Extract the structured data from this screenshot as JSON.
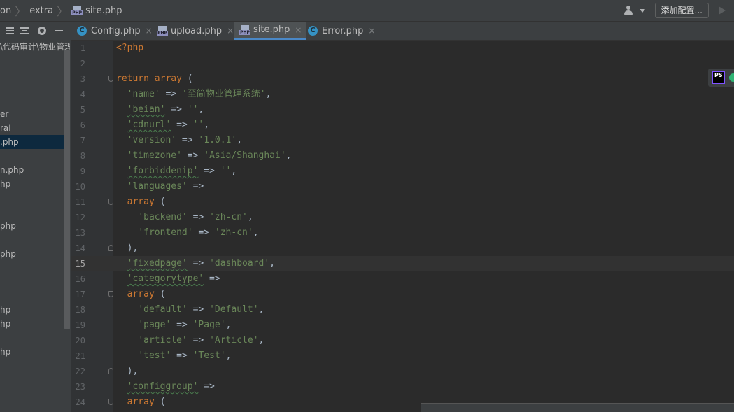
{
  "breadcrumbs": [
    "on",
    "extra",
    "site.php"
  ],
  "toolbar": {
    "config_button": "添加配置..."
  },
  "project_tree": [
    {
      "text": "\\代码审计\\物业管理",
      "selected": false
    },
    {
      "text": "er",
      "selected": false
    },
    {
      "text": "ral",
      "selected": false
    },
    {
      "text": ".php",
      "selected": true
    },
    {
      "text": "n.php",
      "selected": false
    },
    {
      "text": "hp",
      "selected": false
    },
    {
      "text": "php",
      "selected": false
    },
    {
      "text": "php",
      "selected": false
    },
    {
      "text": "hp",
      "selected": false
    },
    {
      "text": "hp",
      "selected": false
    },
    {
      "text": "hp",
      "selected": false
    }
  ],
  "tabs": [
    {
      "label": "Config.php",
      "icon": "php-class-icon",
      "active": false
    },
    {
      "label": "upload.php",
      "icon": "php-file-icon",
      "active": false
    },
    {
      "label": "site.php",
      "icon": "php-file-icon",
      "active": true
    },
    {
      "label": "Error.php",
      "icon": "php-class-icon",
      "active": false
    }
  ],
  "tab_close_glyph": "×",
  "plugin": {
    "logo_text": "PS"
  },
  "current_line": 15,
  "code_lines": [
    {
      "n": 1,
      "fold": "",
      "tokens": [
        [
          "kw",
          "<?php"
        ]
      ]
    },
    {
      "n": 2,
      "fold": "",
      "tokens": []
    },
    {
      "n": 3,
      "fold": "start",
      "tokens": [
        [
          "kw",
          "return array"
        ],
        [
          "plain",
          " ("
        ]
      ]
    },
    {
      "n": 4,
      "fold": "",
      "tokens": [
        [
          "plain",
          "  "
        ],
        [
          "str",
          "'name'"
        ],
        [
          "plain",
          " => "
        ],
        [
          "str",
          "'至简物业管理系统'"
        ],
        [
          "plain",
          ","
        ]
      ]
    },
    {
      "n": 5,
      "fold": "",
      "tokens": [
        [
          "plain",
          "  "
        ],
        [
          "str-typo",
          "'beian'"
        ],
        [
          "plain",
          " => "
        ],
        [
          "str",
          "''"
        ],
        [
          "plain",
          ","
        ]
      ]
    },
    {
      "n": 6,
      "fold": "",
      "tokens": [
        [
          "plain",
          "  "
        ],
        [
          "str-typo",
          "'cdnurl'"
        ],
        [
          "plain",
          " => "
        ],
        [
          "str",
          "''"
        ],
        [
          "plain",
          ","
        ]
      ]
    },
    {
      "n": 7,
      "fold": "",
      "tokens": [
        [
          "plain",
          "  "
        ],
        [
          "str",
          "'version'"
        ],
        [
          "plain",
          " => "
        ],
        [
          "str",
          "'1.0.1'"
        ],
        [
          "plain",
          ","
        ]
      ]
    },
    {
      "n": 8,
      "fold": "",
      "tokens": [
        [
          "plain",
          "  "
        ],
        [
          "str",
          "'timezone'"
        ],
        [
          "plain",
          " => "
        ],
        [
          "str",
          "'Asia/Shanghai'"
        ],
        [
          "plain",
          ","
        ]
      ]
    },
    {
      "n": 9,
      "fold": "",
      "tokens": [
        [
          "plain",
          "  "
        ],
        [
          "str-typo",
          "'forbiddenip'"
        ],
        [
          "plain",
          " => "
        ],
        [
          "str",
          "''"
        ],
        [
          "plain",
          ","
        ]
      ]
    },
    {
      "n": 10,
      "fold": "",
      "tokens": [
        [
          "plain",
          "  "
        ],
        [
          "str",
          "'languages'"
        ],
        [
          "plain",
          " =>"
        ]
      ]
    },
    {
      "n": 11,
      "fold": "start",
      "tokens": [
        [
          "plain",
          "  "
        ],
        [
          "kw",
          "array"
        ],
        [
          "plain",
          " ("
        ]
      ]
    },
    {
      "n": 12,
      "fold": "",
      "tokens": [
        [
          "plain",
          "    "
        ],
        [
          "str",
          "'backend'"
        ],
        [
          "plain",
          " => "
        ],
        [
          "str",
          "'zh-cn'"
        ],
        [
          "plain",
          ","
        ]
      ]
    },
    {
      "n": 13,
      "fold": "",
      "tokens": [
        [
          "plain",
          "    "
        ],
        [
          "str",
          "'frontend'"
        ],
        [
          "plain",
          " => "
        ],
        [
          "str",
          "'zh-cn'"
        ],
        [
          "plain",
          ","
        ]
      ]
    },
    {
      "n": 14,
      "fold": "end",
      "tokens": [
        [
          "plain",
          "  ),"
        ]
      ]
    },
    {
      "n": 15,
      "fold": "",
      "tokens": [
        [
          "plain",
          "  "
        ],
        [
          "str-typo",
          "'fixedpage'"
        ],
        [
          "plain",
          " => "
        ],
        [
          "str",
          "'dashboard'"
        ],
        [
          "plain",
          ","
        ]
      ]
    },
    {
      "n": 16,
      "fold": "",
      "tokens": [
        [
          "plain",
          "  "
        ],
        [
          "str-typo",
          "'categorytype'"
        ],
        [
          "plain",
          " =>"
        ]
      ]
    },
    {
      "n": 17,
      "fold": "start",
      "tokens": [
        [
          "plain",
          "  "
        ],
        [
          "kw",
          "array"
        ],
        [
          "plain",
          " ("
        ]
      ]
    },
    {
      "n": 18,
      "fold": "",
      "tokens": [
        [
          "plain",
          "    "
        ],
        [
          "str",
          "'default'"
        ],
        [
          "plain",
          " => "
        ],
        [
          "str",
          "'Default'"
        ],
        [
          "plain",
          ","
        ]
      ]
    },
    {
      "n": 19,
      "fold": "",
      "tokens": [
        [
          "plain",
          "    "
        ],
        [
          "str",
          "'page'"
        ],
        [
          "plain",
          " => "
        ],
        [
          "str",
          "'Page'"
        ],
        [
          "plain",
          ","
        ]
      ]
    },
    {
      "n": 20,
      "fold": "",
      "tokens": [
        [
          "plain",
          "    "
        ],
        [
          "str",
          "'article'"
        ],
        [
          "plain",
          " => "
        ],
        [
          "str",
          "'Article'"
        ],
        [
          "plain",
          ","
        ]
      ]
    },
    {
      "n": 21,
      "fold": "",
      "tokens": [
        [
          "plain",
          "    "
        ],
        [
          "str",
          "'test'"
        ],
        [
          "plain",
          " => "
        ],
        [
          "str",
          "'Test'"
        ],
        [
          "plain",
          ","
        ]
      ]
    },
    {
      "n": 22,
      "fold": "end",
      "tokens": [
        [
          "plain",
          "  ),"
        ]
      ]
    },
    {
      "n": 23,
      "fold": "",
      "tokens": [
        [
          "plain",
          "  "
        ],
        [
          "str-typo",
          "'configgroup'"
        ],
        [
          "plain",
          " =>"
        ]
      ]
    },
    {
      "n": 24,
      "fold": "start",
      "tokens": [
        [
          "plain",
          "  "
        ],
        [
          "kw",
          "array"
        ],
        [
          "plain",
          " ("
        ]
      ]
    }
  ],
  "colors": {
    "keyword": "#cc7832",
    "string": "#6a8759",
    "text": "#a9b7c6",
    "tab_active_underline": "#4a88c7",
    "selection": "#0d293e"
  }
}
